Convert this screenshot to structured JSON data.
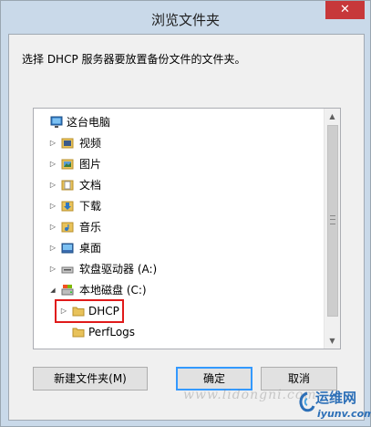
{
  "window": {
    "title": "浏览文件夹",
    "close_symbol": "✕",
    "description": "选择 DHCP 服务器要放置备份文件的文件夹。"
  },
  "tree": {
    "items": [
      {
        "label": "这台电脑",
        "icon": "computer-icon",
        "expander": "none"
      },
      {
        "label": "视频",
        "icon": "video-folder-icon",
        "expander": "collapsed"
      },
      {
        "label": "图片",
        "icon": "pictures-folder-icon",
        "expander": "collapsed"
      },
      {
        "label": "文档",
        "icon": "documents-folder-icon",
        "expander": "collapsed"
      },
      {
        "label": "下载",
        "icon": "downloads-folder-icon",
        "expander": "collapsed"
      },
      {
        "label": "音乐",
        "icon": "music-folder-icon",
        "expander": "collapsed"
      },
      {
        "label": "桌面",
        "icon": "desktop-folder-icon",
        "expander": "collapsed"
      },
      {
        "label": "软盘驱动器 (A:)",
        "icon": "floppy-drive-icon",
        "expander": "collapsed"
      },
      {
        "label": "本地磁盘 (C:)",
        "icon": "local-disk-icon",
        "expander": "expanded"
      },
      {
        "label": "DHCP",
        "icon": "folder-icon",
        "expander": "collapsed",
        "highlighted": true
      },
      {
        "label": "PerfLogs",
        "icon": "folder-icon",
        "expander": "none"
      }
    ]
  },
  "buttons": {
    "new_folder": "新建文件夹(M)",
    "ok": "确定",
    "cancel": "取消"
  },
  "watermark": {
    "text": "www.lidongni.com",
    "logo_text": "运维网",
    "logo_sub": "iyunv.com"
  },
  "colors": {
    "titlebar": "#c9d9e9",
    "close": "#c7383a",
    "highlight_box": "#e01a1a",
    "folder": "#e8c25a"
  }
}
